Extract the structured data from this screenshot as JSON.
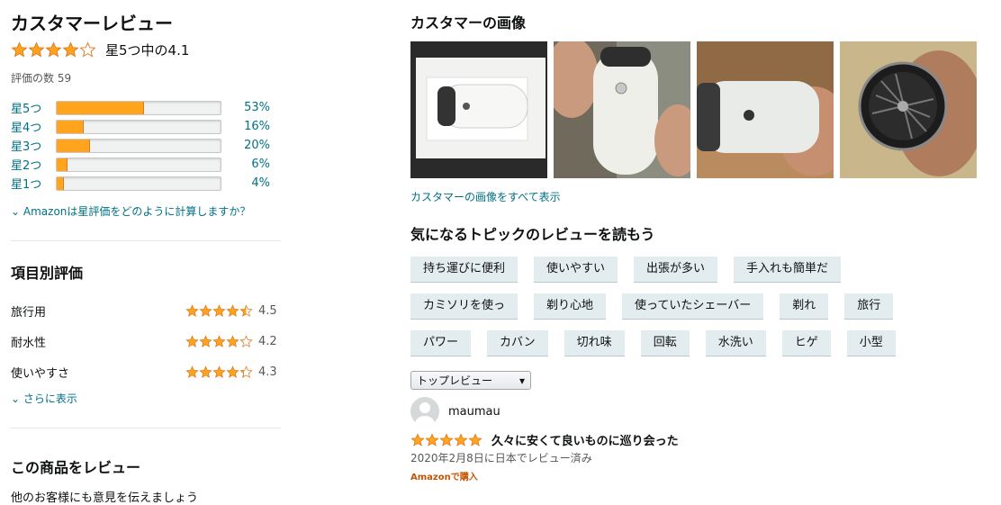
{
  "summary": {
    "title": "カスタマーレビュー",
    "avg_text": "星5つ中の4.1",
    "rating": 4.1,
    "count_text": "評価の数 59",
    "histogram": [
      {
        "label": "星5つ",
        "pct_text": "53%",
        "value": 53
      },
      {
        "label": "星4つ",
        "pct_text": "16%",
        "value": 16
      },
      {
        "label": "星3つ",
        "pct_text": "20%",
        "value": 20
      },
      {
        "label": "星2つ",
        "pct_text": "6%",
        "value": 6
      },
      {
        "label": "星1つ",
        "pct_text": "4%",
        "value": 4
      }
    ],
    "calc_link": "Amazonは星評価をどのように計算しますか？"
  },
  "attributes": {
    "title": "項目別評価",
    "items": [
      {
        "name": "旅行用",
        "value": "4.5",
        "rating": 4.5
      },
      {
        "name": "耐水性",
        "value": "4.2",
        "rating": 4.2
      },
      {
        "name": "使いやすさ",
        "value": "4.3",
        "rating": 4.3
      }
    ],
    "more_link": "さらに表示"
  },
  "write": {
    "title": "この商品をレビュー",
    "subtitle": "他のお客様にも意見を伝えましょう"
  },
  "images": {
    "title": "カスタマーの画像",
    "all_link": "カスタマーの画像をすべて表示",
    "thumb_names": [
      "shaver-in-box",
      "shaver-in-hand",
      "shaver-side",
      "shaver-head"
    ]
  },
  "topics": {
    "title": "気になるトピックのレビューを読もう",
    "rows": [
      [
        "持ち運びに便利",
        "使いやすい",
        "出張が多い",
        "手入れも簡単だ"
      ],
      [
        "カミソリを使っ",
        "剃り心地",
        "使っていたシェーバー",
        "剃れ",
        "旅行"
      ],
      [
        "パワー",
        "カバン",
        "切れ味",
        "回転",
        "水洗い",
        "ヒゲ",
        "小型"
      ]
    ]
  },
  "sort": {
    "selected": "トップレビュー"
  },
  "review": {
    "author": "maumau",
    "rating": 5,
    "title": "久々に安くて良いものに巡り会った",
    "date": "2020年2月8日に日本でレビュー済み",
    "badge": "Amazonで購入"
  },
  "colors": {
    "star": "#ffa41c",
    "star_stroke": "#de7921",
    "link": "#007185",
    "chip": "#e3ecef",
    "badge": "#c45500"
  }
}
